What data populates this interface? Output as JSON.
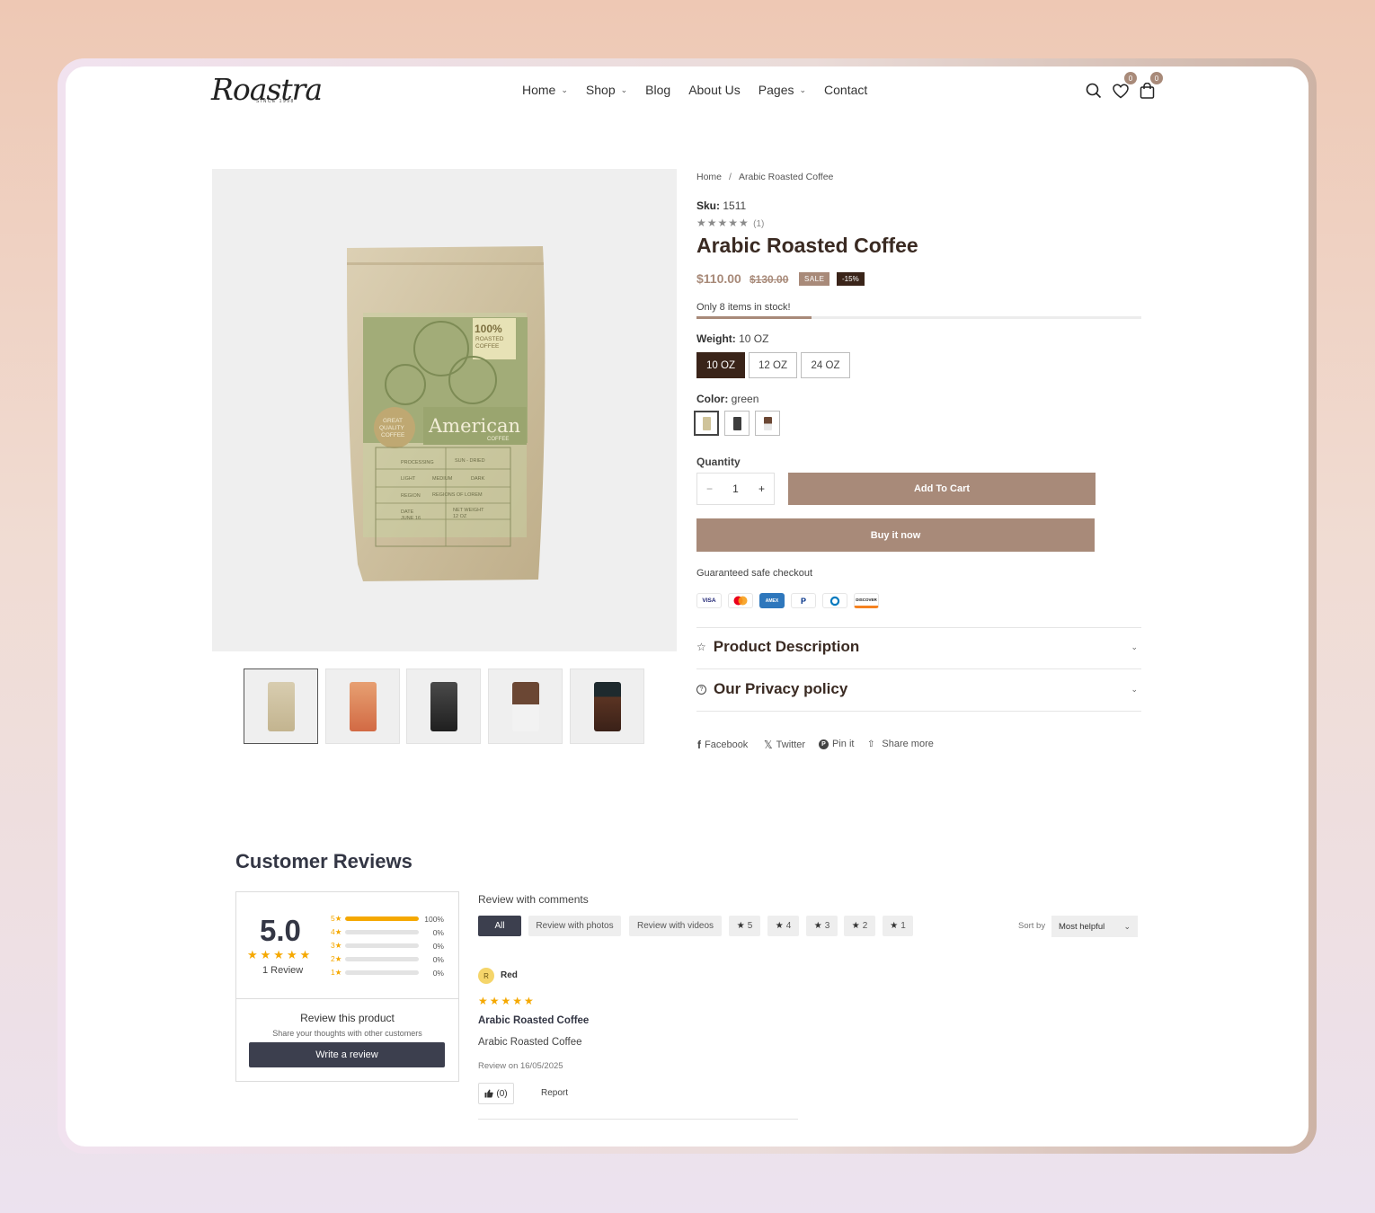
{
  "brand": {
    "logo_text": "Roastra",
    "logo_sub": "SINCE 1998"
  },
  "nav": {
    "items": [
      {
        "label": "Home",
        "has_dropdown": true
      },
      {
        "label": "Shop",
        "has_dropdown": true
      },
      {
        "label": "Blog",
        "has_dropdown": false
      },
      {
        "label": "About Us",
        "has_dropdown": false
      },
      {
        "label": "Pages",
        "has_dropdown": true
      },
      {
        "label": "Contact",
        "has_dropdown": false
      }
    ],
    "wishlist_count": "0",
    "cart_count": "0"
  },
  "product_image": {
    "badge_100": "100%",
    "badge_roasted": "ROASTED",
    "badge_coffee": "COFFEE",
    "quality_line1": "GREAT",
    "quality_line2": "QUALITY",
    "quality_line3": "COFFEE",
    "brand": "American",
    "brand_sub": "COFFEE",
    "table": [
      [
        "PROCESSING",
        "SUN - DRIED"
      ],
      [
        "LIGHT",
        "MEDIUM",
        "DARK"
      ],
      [
        "REGION",
        "REGIONS OF LOREM"
      ],
      [
        "DATE",
        "NET WEIGHT"
      ],
      [
        "JUNE 16",
        "12 OZ"
      ]
    ]
  },
  "breadcrumb": {
    "home": "Home",
    "separator": "/",
    "current": "Arabic Roasted Coffee"
  },
  "product": {
    "sku_label": "Sku:",
    "sku": "1511",
    "stars": "★★★★★",
    "review_count": "(1)",
    "title": "Arabic Roasted Coffee",
    "price": "$110.00",
    "old_price": "$130.00",
    "sale_tag": "SALE",
    "discount_tag": "-15%",
    "stock_text": "Only 8 items in stock!",
    "weight_label": "Weight:",
    "weight_value": "10 OZ",
    "weights": [
      "10 OZ",
      "12 OZ",
      "24 OZ"
    ],
    "color_label": "Color:",
    "color_value": "green",
    "quantity_label": "Quantity",
    "quantity": "1",
    "add_to_cart": "Add To Cart",
    "buy_now": "Buy it now",
    "checkout_text": "Guaranteed safe checkout",
    "payments": [
      "VISA",
      "Mastercard",
      "AMEX",
      "PayPal",
      "Diners",
      "DISCOVER"
    ]
  },
  "accordions": [
    {
      "title": "Product Description",
      "icon": "star-outline-icon"
    },
    {
      "title": "Our Privacy policy",
      "icon": "question-circle-icon"
    }
  ],
  "share": {
    "facebook": "Facebook",
    "twitter": "Twitter",
    "pinterest": "Pin it",
    "more": "Share more"
  },
  "reviews": {
    "heading": "Customer Reviews",
    "score": "5.0",
    "stars": "★★★★★",
    "count_text": "1 Review",
    "breakdown": [
      {
        "stars": "5",
        "pct": "100%",
        "fraction": 1.0
      },
      {
        "stars": "4",
        "pct": "0%",
        "fraction": 0
      },
      {
        "stars": "3",
        "pct": "0%",
        "fraction": 0
      },
      {
        "stars": "2",
        "pct": "0%",
        "fraction": 0
      },
      {
        "stars": "1",
        "pct": "0%",
        "fraction": 0
      }
    ],
    "review_prompt": "Review this product",
    "review_sub": "Share your thoughts with other customers",
    "write_btn": "Write a review",
    "comments_label": "Review with comments",
    "filters": [
      "All",
      "Review with photos",
      "Review with videos",
      "5",
      "4",
      "3",
      "2",
      "1"
    ],
    "sort_label": "Sort by",
    "sort_value": "Most helpful",
    "item": {
      "avatar": "R",
      "author": "Red",
      "stars": "★★★★★",
      "title": "Arabic Roasted Coffee",
      "body": "Arabic Roasted Coffee",
      "date": "Review on 16/05/2025",
      "helpful": "(0)",
      "report": "Report"
    }
  },
  "colors": {
    "accent": "#a88a79",
    "dark": "#3a2419",
    "review_dark": "#3c3f4e",
    "gold": "#f5a800"
  }
}
